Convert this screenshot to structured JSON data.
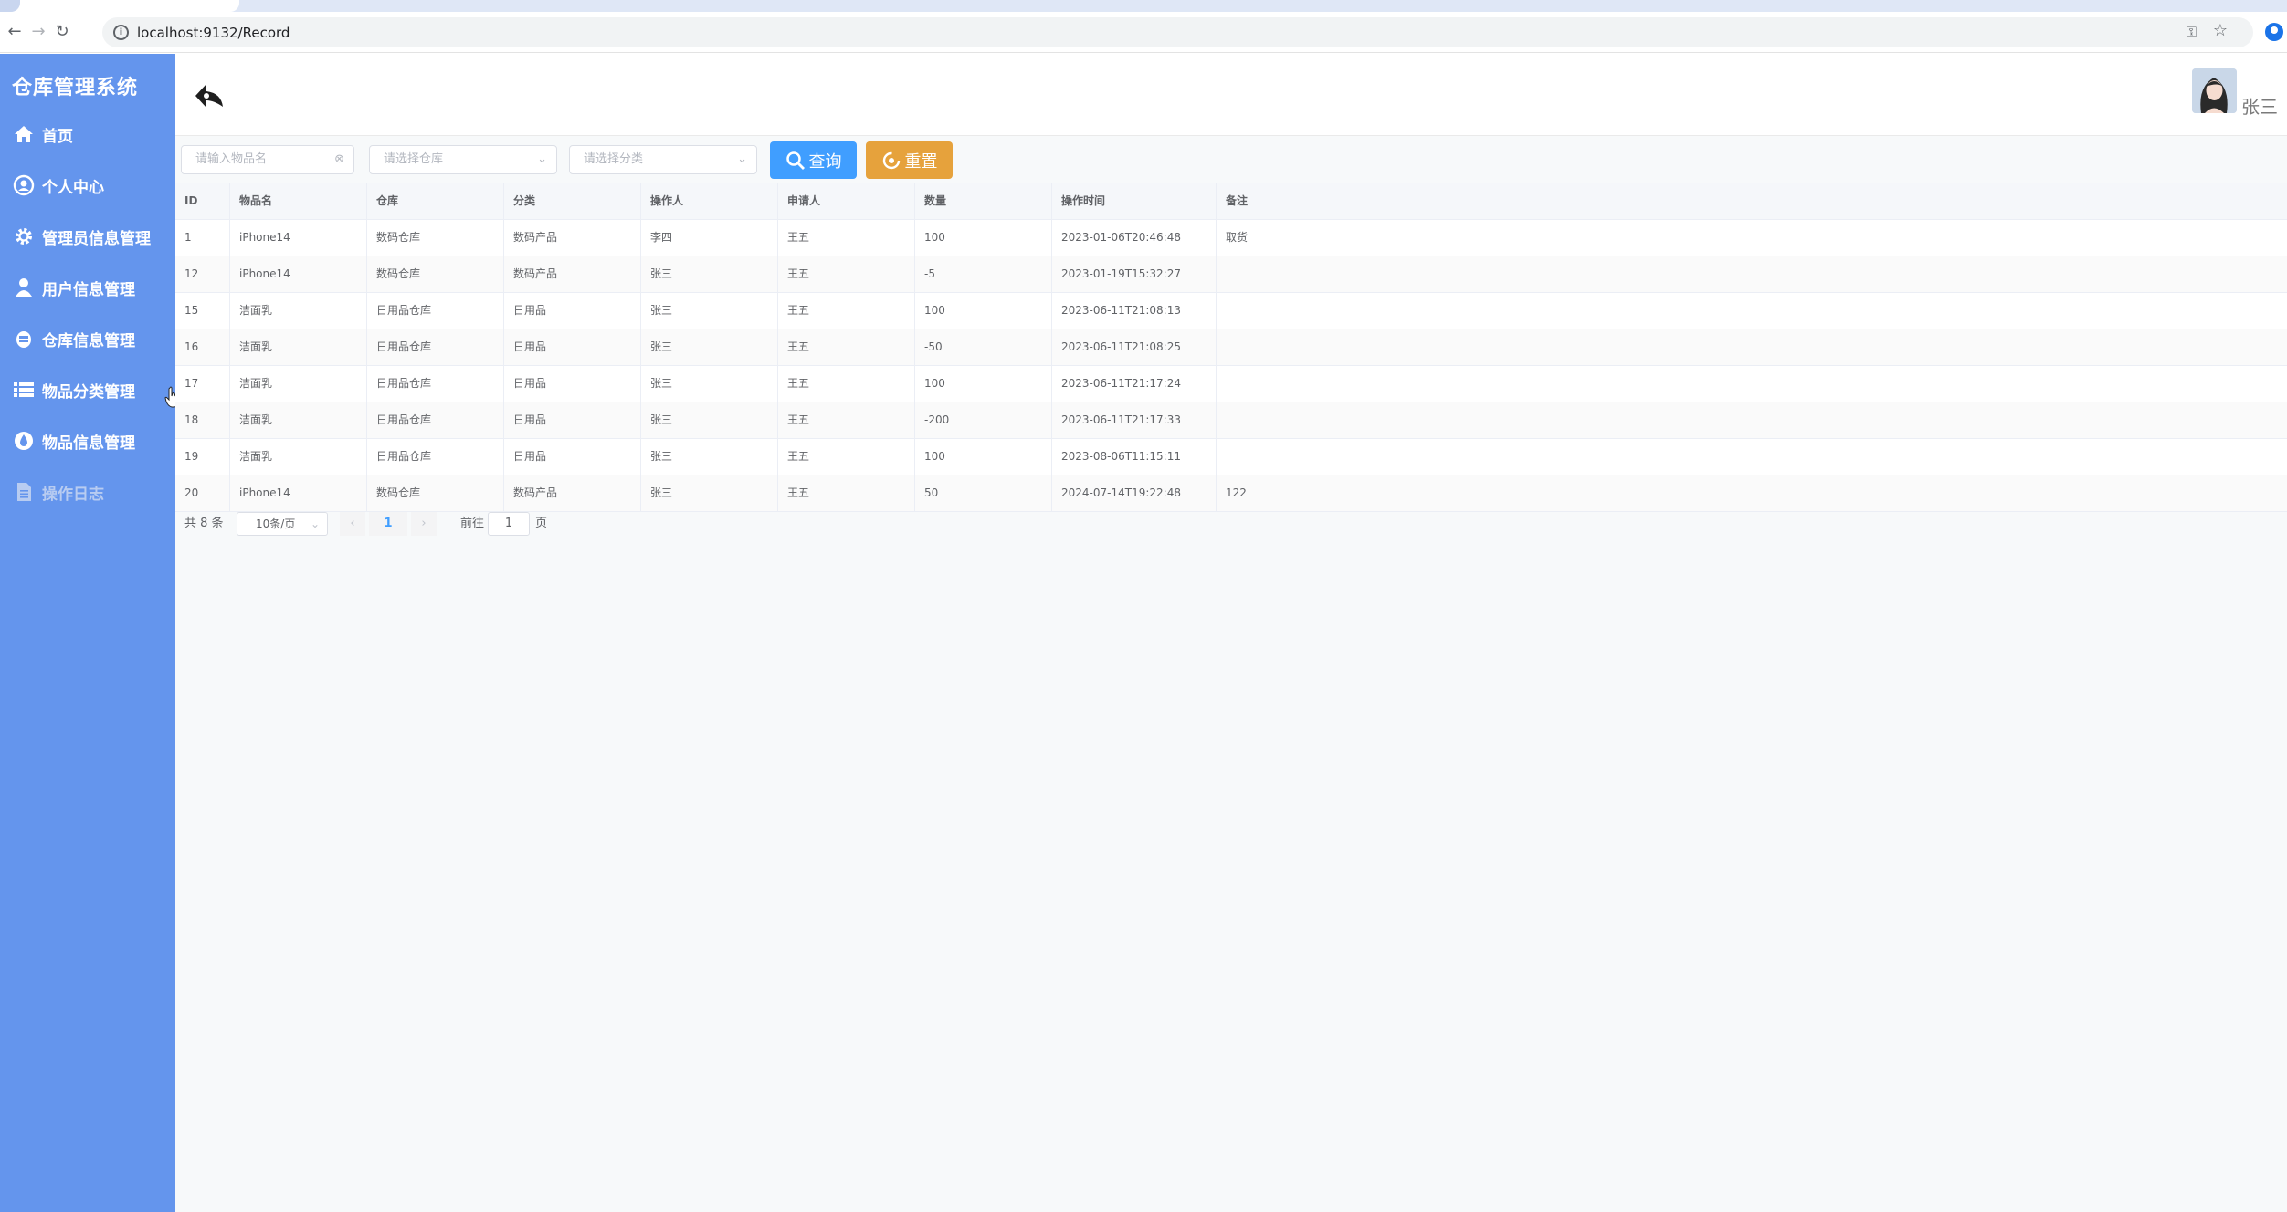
{
  "browser": {
    "url": "localhost:9132/Record"
  },
  "sidebar": {
    "brand": "仓库管理系统",
    "items": [
      {
        "label": "首页",
        "icon": "home-icon"
      },
      {
        "label": "个人中心",
        "icon": "user-center-icon"
      },
      {
        "label": "管理员信息管理",
        "icon": "gear-icon"
      },
      {
        "label": "用户信息管理",
        "icon": "person-icon"
      },
      {
        "label": "仓库信息管理",
        "icon": "warehouse-icon"
      },
      {
        "label": "物品分类管理",
        "icon": "list-icon"
      },
      {
        "label": "物品信息管理",
        "icon": "drop-icon"
      },
      {
        "label": "操作日志",
        "icon": "document-icon",
        "active": true
      }
    ]
  },
  "header": {
    "username": "张三"
  },
  "filters": {
    "item_placeholder": "请输入物品名",
    "warehouse_placeholder": "请选择仓库",
    "category_placeholder": "请选择分类",
    "query_label": "查询",
    "reset_label": "重置"
  },
  "table": {
    "columns": [
      "ID",
      "物品名",
      "仓库",
      "分类",
      "操作人",
      "申请人",
      "数量",
      "操作时间",
      "备注"
    ],
    "rows": [
      [
        "1",
        "iPhone14",
        "数码仓库",
        "数码产品",
        "李四",
        "王五",
        "100",
        "2023-01-06T20:46:48",
        "取货"
      ],
      [
        "12",
        "iPhone14",
        "数码仓库",
        "数码产品",
        "张三",
        "王五",
        "-5",
        "2023-01-19T15:32:27",
        ""
      ],
      [
        "15",
        "洁面乳",
        "日用品仓库",
        "日用品",
        "张三",
        "王五",
        "100",
        "2023-06-11T21:08:13",
        ""
      ],
      [
        "16",
        "洁面乳",
        "日用品仓库",
        "日用品",
        "张三",
        "王五",
        "-50",
        "2023-06-11T21:08:25",
        ""
      ],
      [
        "17",
        "洁面乳",
        "日用品仓库",
        "日用品",
        "张三",
        "王五",
        "100",
        "2023-06-11T21:17:24",
        ""
      ],
      [
        "18",
        "洁面乳",
        "日用品仓库",
        "日用品",
        "张三",
        "王五",
        "-200",
        "2023-06-11T21:17:33",
        ""
      ],
      [
        "19",
        "洁面乳",
        "日用品仓库",
        "日用品",
        "张三",
        "王五",
        "100",
        "2023-08-06T11:15:11",
        ""
      ],
      [
        "20",
        "iPhone14",
        "数码仓库",
        "数码产品",
        "张三",
        "王五",
        "50",
        "2024-07-14T19:22:48",
        "122"
      ]
    ]
  },
  "pagination": {
    "total": "共 8 条",
    "page_size": "10条/页",
    "current_page": "1",
    "goto_prefix": "前往",
    "goto_value": "1",
    "goto_suffix": "页"
  },
  "colors": {
    "sidebar": "#6495ed",
    "primary": "#409eff",
    "warning": "#e6a23c"
  }
}
